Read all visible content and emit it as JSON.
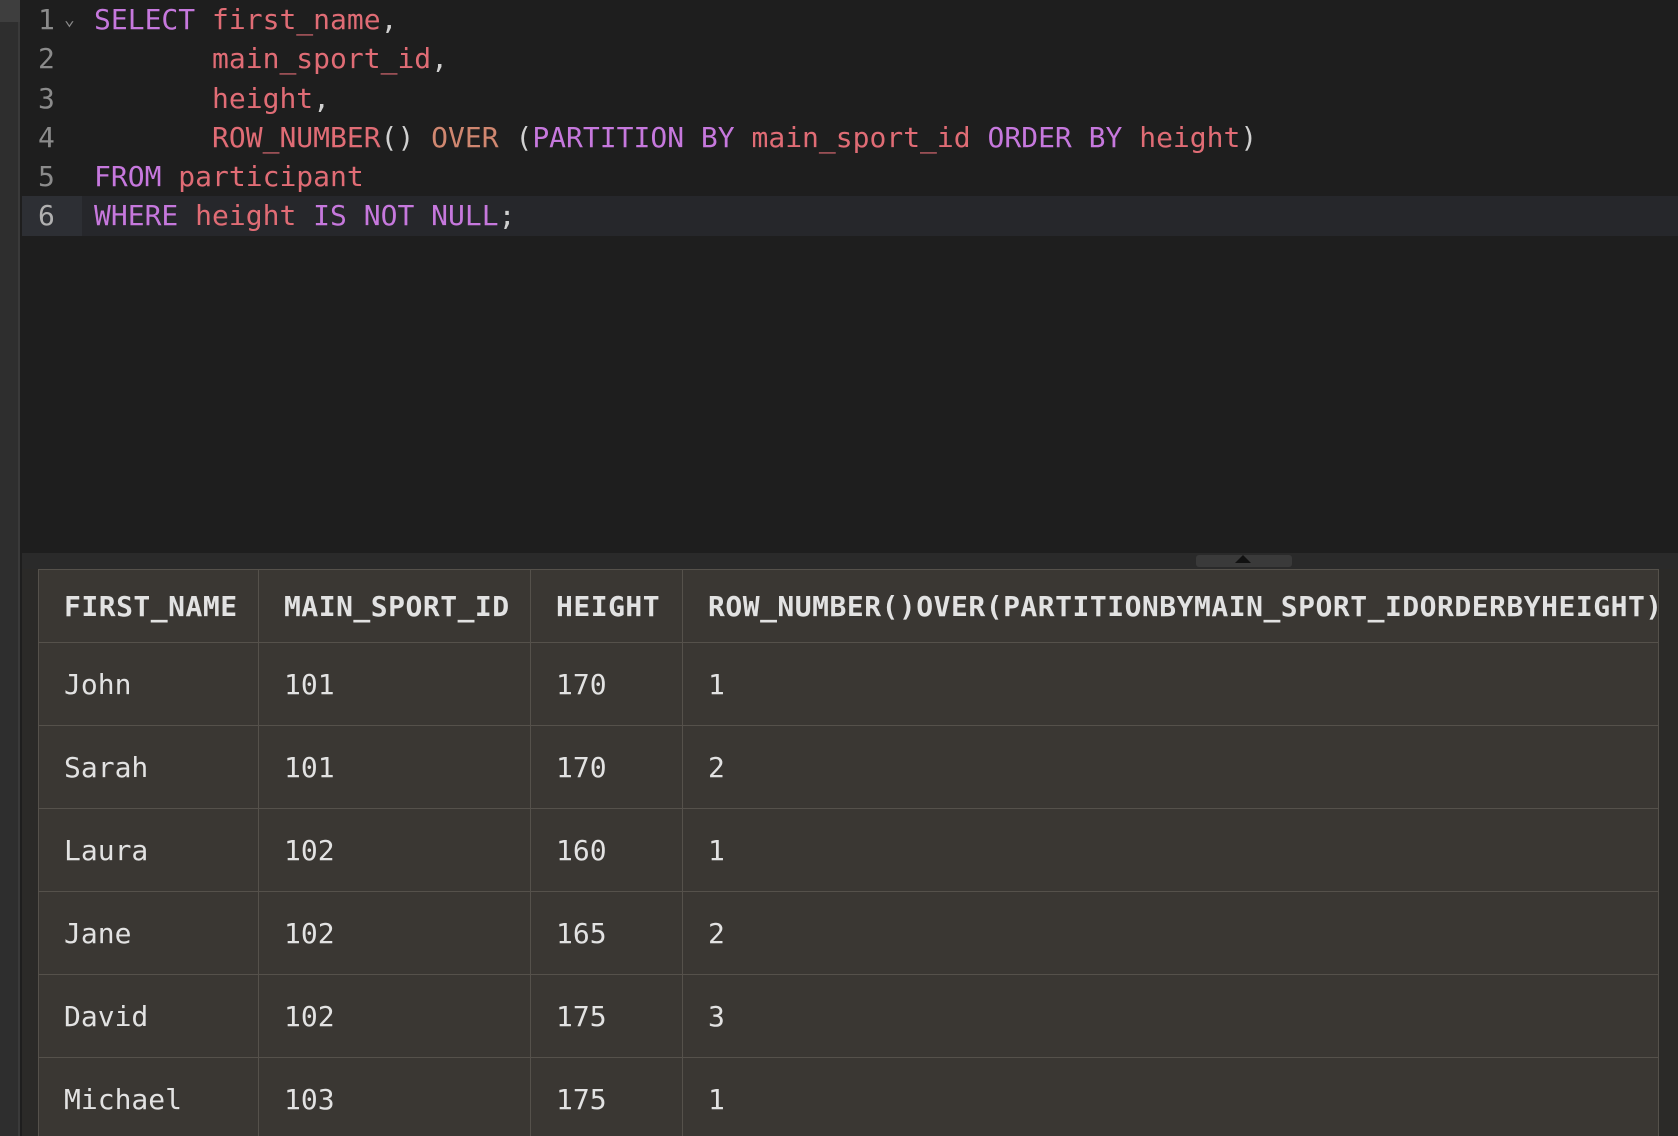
{
  "editor": {
    "lines": [
      {
        "num": "1",
        "fold": "⌄",
        "tokens": [
          {
            "t": "SELECT",
            "c": "kw"
          },
          {
            "t": " ",
            "c": "pn"
          },
          {
            "t": "first_name",
            "c": "id"
          },
          {
            "t": ",",
            "c": "pn"
          }
        ]
      },
      {
        "num": "2",
        "tokens": [
          {
            "t": "       ",
            "c": "pn"
          },
          {
            "t": "main_sport_id",
            "c": "id"
          },
          {
            "t": ",",
            "c": "pn"
          }
        ]
      },
      {
        "num": "3",
        "tokens": [
          {
            "t": "       ",
            "c": "pn"
          },
          {
            "t": "height",
            "c": "id"
          },
          {
            "t": ",",
            "c": "pn"
          }
        ]
      },
      {
        "num": "4",
        "tokens": [
          {
            "t": "       ",
            "c": "pn"
          },
          {
            "t": "ROW_NUMBER",
            "c": "fn"
          },
          {
            "t": "() ",
            "c": "pn"
          },
          {
            "t": "OVER",
            "c": "op"
          },
          {
            "t": " (",
            "c": "pn"
          },
          {
            "t": "PARTITION BY",
            "c": "kw"
          },
          {
            "t": " ",
            "c": "pn"
          },
          {
            "t": "main_sport_id",
            "c": "id"
          },
          {
            "t": " ",
            "c": "pn"
          },
          {
            "t": "ORDER BY",
            "c": "kw"
          },
          {
            "t": " ",
            "c": "pn"
          },
          {
            "t": "height",
            "c": "id"
          },
          {
            "t": ")",
            "c": "pn"
          }
        ]
      },
      {
        "num": "5",
        "tokens": [
          {
            "t": "FROM",
            "c": "kw"
          },
          {
            "t": " ",
            "c": "pn"
          },
          {
            "t": "participant",
            "c": "id"
          }
        ]
      },
      {
        "num": "6",
        "active": true,
        "tokens": [
          {
            "t": "WHERE",
            "c": "kw"
          },
          {
            "t": " ",
            "c": "pn"
          },
          {
            "t": "height",
            "c": "id"
          },
          {
            "t": " ",
            "c": "pn"
          },
          {
            "t": "IS NOT NULL",
            "c": "kw"
          },
          {
            "t": ";",
            "c": "pn"
          }
        ]
      }
    ]
  },
  "results": {
    "columns": [
      "FIRST_NAME",
      "MAIN_SPORT_ID",
      "HEIGHT",
      "ROW_NUMBER()OVER(PARTITIONBYMAIN_SPORT_IDORDERBYHEIGHT)"
    ],
    "rows": [
      [
        "John",
        "101",
        "170",
        "1"
      ],
      [
        "Sarah",
        "101",
        "170",
        "2"
      ],
      [
        "Laura",
        "102",
        "160",
        "1"
      ],
      [
        "Jane",
        "102",
        "165",
        "2"
      ],
      [
        "David",
        "102",
        "175",
        "3"
      ],
      [
        "Michael",
        "103",
        "175",
        "1"
      ]
    ]
  },
  "colors": {
    "editor_bg": "#1e1e1e",
    "keyword": "#c678dd",
    "identifier": "#e06c75",
    "results_bg": "#3a3733"
  },
  "icons": {
    "fold": "chevron-down-icon",
    "splitter": "caret-up-icon"
  }
}
